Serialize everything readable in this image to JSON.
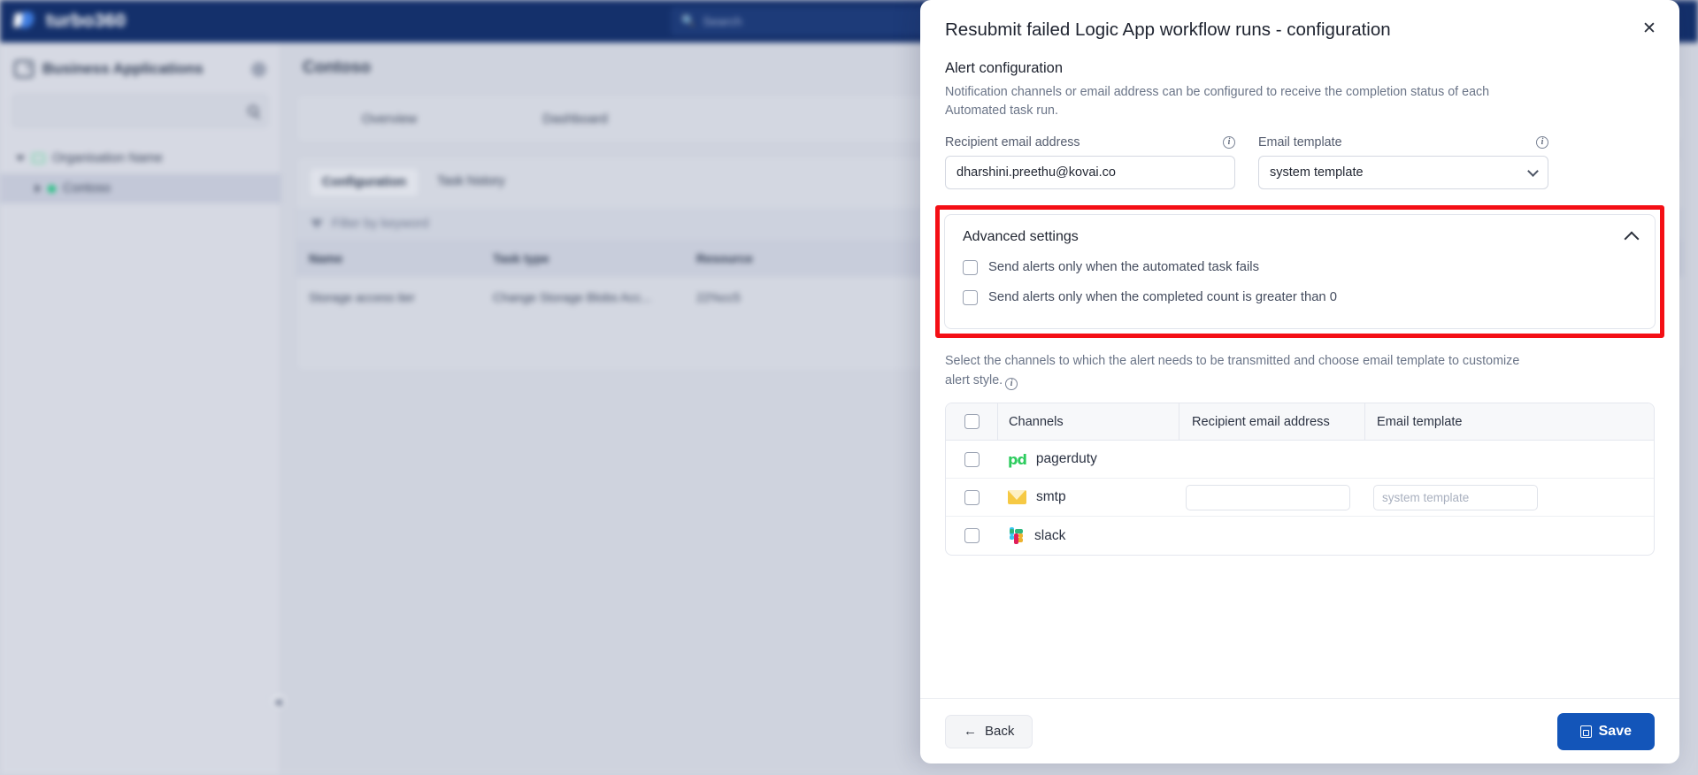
{
  "background": {
    "brand": "turbo360",
    "topbar_search_placeholder": "Search",
    "sidebar": {
      "title": "Business Applications",
      "search_placeholder": "",
      "tree": [
        {
          "label": "Organisation Name"
        },
        {
          "label": "Contoso"
        }
      ]
    },
    "content": {
      "title": "Contoso",
      "tabs": [
        "Overview",
        "Dashboard"
      ],
      "subtabs": [
        "Configuration",
        "Task history"
      ],
      "filter_placeholder": "Filter by keyword",
      "table": {
        "columns": [
          "Name",
          "Task type",
          "Resource"
        ],
        "rows": [
          [
            "Storage access tier",
            "Change Storage Blobs Acc...",
            "22%cc5"
          ]
        ]
      }
    }
  },
  "modal": {
    "title": "Resubmit failed Logic App workflow runs - configuration",
    "close_label": "✕",
    "alert": {
      "heading": "Alert configuration",
      "description": "Notification channels or email address can be configured to receive the completion status of each Automated task run.",
      "recipient_label": "Recipient email address",
      "recipient_value": "dharshini.preethu@kovai.co",
      "template_label": "Email template",
      "template_value": "system template",
      "info_glyph": "i"
    },
    "advanced": {
      "title": "Advanced settings",
      "expanded": true,
      "highlight_color": "#f40f15",
      "options": [
        {
          "label": "Send alerts only when the automated task fails",
          "checked": false
        },
        {
          "label": "Send alerts only when the completed count is greater than 0",
          "checked": false
        }
      ]
    },
    "channels": {
      "description": "Select the channels to which the alert needs to be transmitted and choose email template to customize alert style.",
      "columns": [
        "Channels",
        "Recipient email address",
        "Email template"
      ],
      "select_all_checked": false,
      "rows": [
        {
          "name": "pagerduty",
          "icon": "pagerduty-logo",
          "checked": false,
          "email_value": "",
          "email_visible": false,
          "template_placeholder": "",
          "template_visible": false
        },
        {
          "name": "smtp",
          "icon": "smtp-logo",
          "checked": false,
          "email_value": "",
          "email_visible": true,
          "email_placeholder": "",
          "template_placeholder": "system template",
          "template_visible": true
        },
        {
          "name": "slack",
          "icon": "slack-logo",
          "checked": false,
          "email_value": "",
          "email_visible": false,
          "template_placeholder": "",
          "template_visible": false
        }
      ]
    },
    "footer": {
      "back_label": "Back",
      "back_arrow": "←",
      "save_label": "Save",
      "save_color": "#1355b9"
    }
  }
}
